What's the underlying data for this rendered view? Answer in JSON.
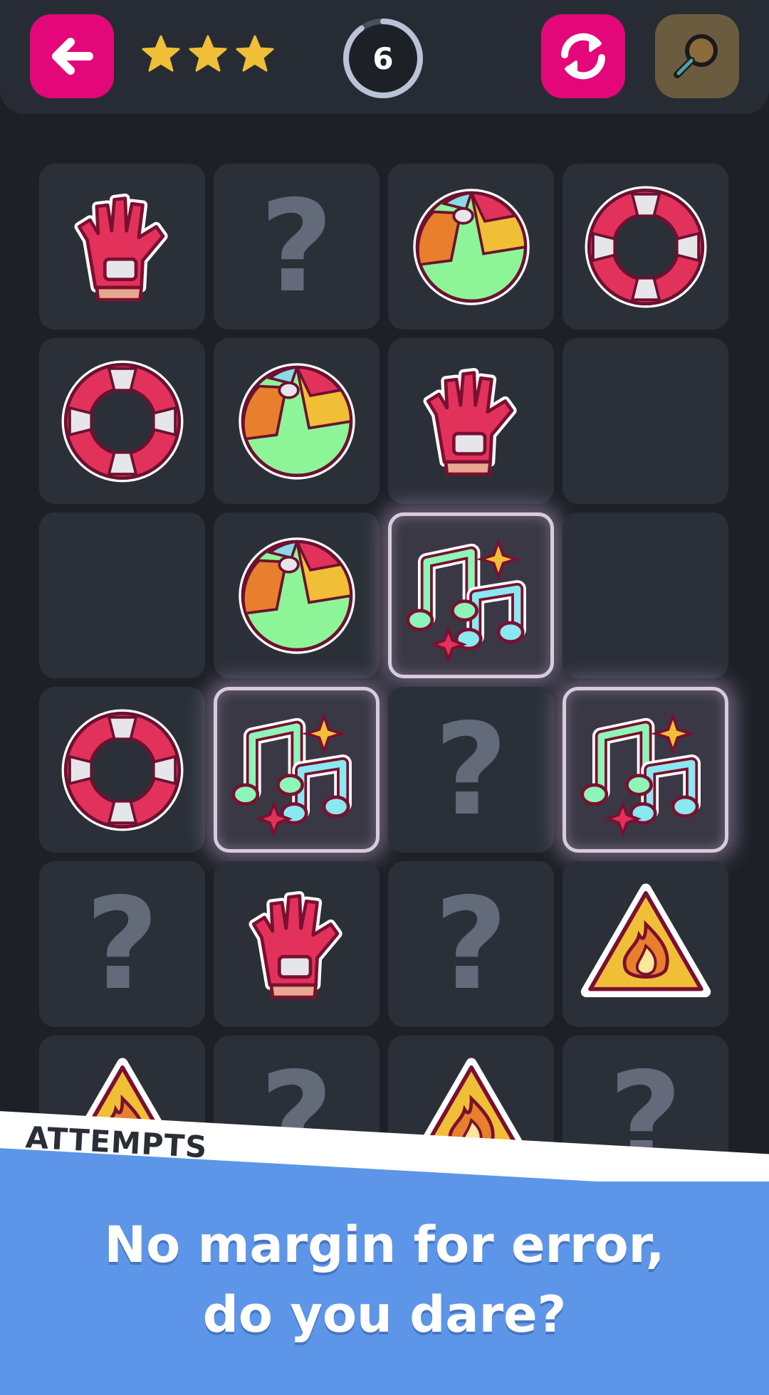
{
  "topbar": {
    "back_icon": "arrow-left-icon",
    "stars_earned": 3,
    "stars_total": 3,
    "counter": "6",
    "counter_progress": 0.9,
    "reload_icon": "reload-icon",
    "hint_icon": "magnifier-icon"
  },
  "grid": {
    "rows": [
      [
        "glove",
        "unknown",
        "beach-ball",
        "lifebuoy"
      ],
      [
        "lifebuoy",
        "beach-ball",
        "glove",
        "empty"
      ],
      [
        "empty",
        "beach-ball",
        "music-notes",
        "empty"
      ],
      [
        "lifebuoy",
        "music-notes",
        "unknown",
        "music-notes"
      ],
      [
        "unknown",
        "glove",
        "unknown",
        "fire-warning"
      ],
      [
        "fire-warning",
        "unknown",
        "fire-warning",
        "unknown"
      ]
    ],
    "selected": [
      [
        2,
        2
      ],
      [
        3,
        1
      ],
      [
        3,
        3
      ]
    ],
    "unknown_symbol": "?"
  },
  "colors": {
    "accent": "#e3077a",
    "star": "#f1be37",
    "banner": "#5d96e9",
    "tile": "#2b3038",
    "background": "#1d2127"
  },
  "banner": {
    "label": "ATTEMPTS",
    "tagline_line1": "No margin for error,",
    "tagline_line2": "do you dare?"
  }
}
